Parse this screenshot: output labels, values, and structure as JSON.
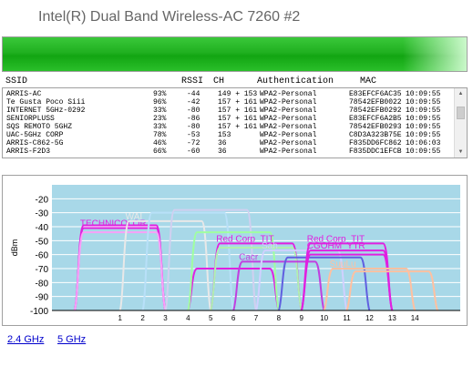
{
  "window": {
    "title": "Intel(R) Dual Band Wireless-AC 7260 #2"
  },
  "signal": {
    "level": 1.0,
    "color": "#22b022"
  },
  "table": {
    "headers": {
      "ssid": "SSID",
      "rssi": "RSSI",
      "ch": "CH",
      "auth": "Authentication",
      "mac": "MAC"
    },
    "rows": [
      {
        "ssid": "ARRIS-AC",
        "quality": "93%",
        "rssi": "-44",
        "ch": "149 + 153",
        "auth": "WPA2-Personal",
        "mac": "E83EFCF6AC35",
        "time": "10:09:55"
      },
      {
        "ssid": "Te Gusta Poco Siii",
        "quality": "96%",
        "rssi": "-42",
        "ch": "157 + 161",
        "auth": "WPA2-Personal",
        "mac": "78542EFB0022",
        "time": "10:09:55"
      },
      {
        "ssid": "INTERNET 5GHz-0292",
        "quality": "33%",
        "rssi": "-80",
        "ch": "157 + 161",
        "auth": "WPA2-Personal",
        "mac": "78542EFB0292",
        "time": "10:09:55"
      },
      {
        "ssid": "SENIORPLUSS",
        "quality": "23%",
        "rssi": "-86",
        "ch": "157 + 161",
        "auth": "WPA2-Personal",
        "mac": "E83EFCF6A2B5",
        "time": "10:09:55"
      },
      {
        "ssid": "SQS REMOTO 5GHZ",
        "quality": "33%",
        "rssi": "-80",
        "ch": "157 + 161",
        "auth": "WPA2-Personal",
        "mac": "78542EFB0293",
        "time": "10:09:55"
      },
      {
        "ssid": "UAC-5GHz CORP",
        "quality": "78%",
        "rssi": "-53",
        "ch": "153",
        "auth": "WPA2-Personal",
        "mac": "C8D3A323B75E",
        "time": "10:09:55"
      },
      {
        "ssid": "ARRIS-C862-5G",
        "quality": "46%",
        "rssi": "-72",
        "ch": "36",
        "auth": "WPA2-Personal",
        "mac": "F835DD6FC862",
        "time": "10:06:03"
      },
      {
        "ssid": "ARRIS-F2D3",
        "quality": "66%",
        "rssi": "-60",
        "ch": "36",
        "auth": "WPA2-Personal",
        "mac": "F835DDC1EFCB",
        "time": "10:09:55"
      }
    ]
  },
  "chart_data": {
    "type": "area",
    "ylabel": "dBm",
    "ylim": [
      -100,
      -10
    ],
    "yticks": [
      -20,
      -30,
      -40,
      -50,
      -60,
      -70,
      -80,
      -90,
      -100
    ],
    "xlim": [
      -2,
      16
    ],
    "xticks": [
      1,
      2,
      3,
      4,
      5,
      6,
      7,
      8,
      9,
      10,
      11,
      12,
      13,
      14
    ],
    "background": "#a8d8e8",
    "series": [
      {
        "name": "TECHNICOLOR",
        "channel": 1,
        "rssi": -41,
        "color": "#e020e0"
      },
      {
        "name": "",
        "channel": 1,
        "rssi": -39,
        "color": "#e020e0"
      },
      {
        "name": "",
        "channel": 1,
        "rssi": -44,
        "color": "#f8a0f8"
      },
      {
        "name": "WAI",
        "channel": 3,
        "rssi": -36,
        "color": "#e8e8e8"
      },
      {
        "name": "",
        "channel": 4,
        "rssi": -30,
        "color": "#b8e0f8"
      },
      {
        "name": "",
        "channel": 5,
        "rssi": -28,
        "color": "#d0d0f0"
      },
      {
        "name": "",
        "channel": 6,
        "rssi": -70,
        "color": "#e020e0"
      },
      {
        "name": "",
        "channel": 6,
        "rssi": -44,
        "color": "#a0ffa0"
      },
      {
        "name": "Red Corp_TIT",
        "channel": 7,
        "rssi": -52,
        "color": "#e020e0"
      },
      {
        "name": "",
        "channel": 7,
        "rssi": -55,
        "color": "#b0f0b0"
      },
      {
        "name": "Cacr",
        "channel": 8,
        "rssi": -65,
        "color": "#c040e0"
      },
      {
        "name": "Sah",
        "channel": 9,
        "rssi": -57,
        "color": "#d0d0ff"
      },
      {
        "name": "",
        "channel": 10,
        "rssi": -62,
        "color": "#6060e0"
      },
      {
        "name": "Red Corp_TIT",
        "channel": 11,
        "rssi": -52,
        "color": "#e020e0"
      },
      {
        "name": "CGOHM_YTR",
        "channel": 11,
        "rssi": -57,
        "color": "#e020e0"
      },
      {
        "name": "",
        "channel": 11,
        "rssi": -60,
        "color": "#e020e0"
      },
      {
        "name": "SuuLu",
        "channel": 12,
        "rssi": -70,
        "color": "#ffc0a0"
      },
      {
        "name": "",
        "channel": 13,
        "rssi": -72,
        "color": "#ffc0a0"
      }
    ]
  },
  "tabs": {
    "band24": "2.4 GHz",
    "band5": "5 GHz"
  }
}
